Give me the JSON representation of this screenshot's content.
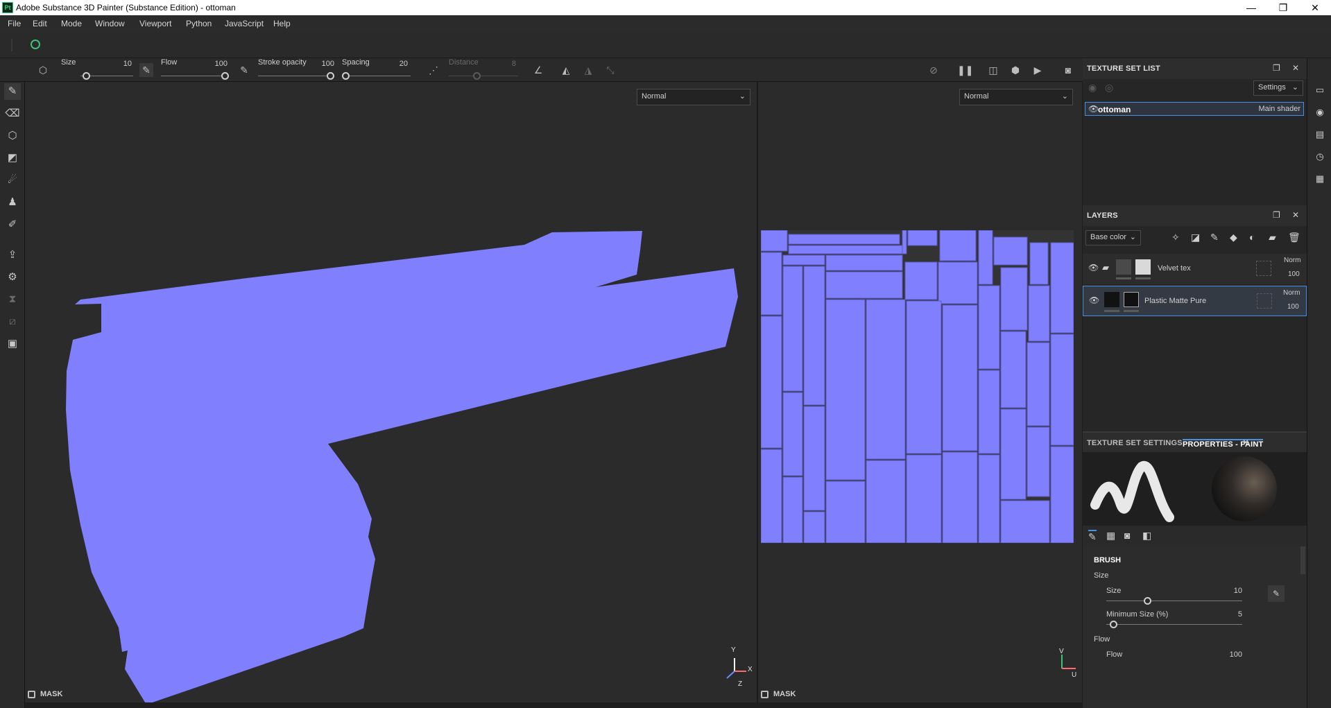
{
  "window": {
    "title": "Adobe Substance 3D Painter (Substance Edition) - ottoman",
    "logo_text": "Pt",
    "minimize": "—",
    "restore": "❐",
    "close": "✕"
  },
  "menu": [
    "File",
    "Edit",
    "Mode",
    "Window",
    "Viewport",
    "Python",
    "JavaScript",
    "Help"
  ],
  "toolbar": {
    "size_label": "Size",
    "size_value": "10",
    "size_level": 0.1,
    "flow_label": "Flow",
    "flow_value": "100",
    "flow_level": 1.0,
    "stroke_opacity_label": "Stroke opacity",
    "stroke_opacity_value": "100",
    "stroke_opacity_level": 1.0,
    "spacing_label": "Spacing",
    "spacing_value": "20",
    "spacing_level": 0.02,
    "distance_label": "Distance",
    "distance_value": "8",
    "distance_level": 0.4
  },
  "viewport3d": {
    "blend_mode": "Normal",
    "mask_label": "MASK",
    "axis_y": "Y",
    "axis_x": "X",
    "axis_z": "Z",
    "mesh_color": "#8080ff"
  },
  "viewport2d": {
    "blend_mode": "Normal",
    "mask_label": "MASK",
    "axis_v": "V",
    "axis_u": "U",
    "uv_color": "#8080ff"
  },
  "texture_set_list": {
    "title": "TEXTURE SET LIST",
    "settings_label": "Settings",
    "item_name": "ottoman",
    "item_shader": "Main shader"
  },
  "layers": {
    "title": "LAYERS",
    "channel": "Base color",
    "items": [
      {
        "name": "Velvet tex",
        "blend": "Norm",
        "opacity": "100"
      },
      {
        "name": "Plastic Matte Pure",
        "blend": "Norm",
        "opacity": "100"
      }
    ]
  },
  "properties": {
    "tab_texture_set_settings": "TEXTURE SET SETTINGS",
    "tab_properties_paint": "PROPERTIES - PAINT",
    "section_brush": "BRUSH",
    "group_size": "Size",
    "size_label": "Size",
    "size_value": "10",
    "size_level": 0.3,
    "min_size_label": "Minimum Size (%)",
    "min_size_value": "5",
    "min_size_level": 0.05,
    "group_flow": "Flow",
    "flow_label": "Flow",
    "flow_value": "100"
  }
}
